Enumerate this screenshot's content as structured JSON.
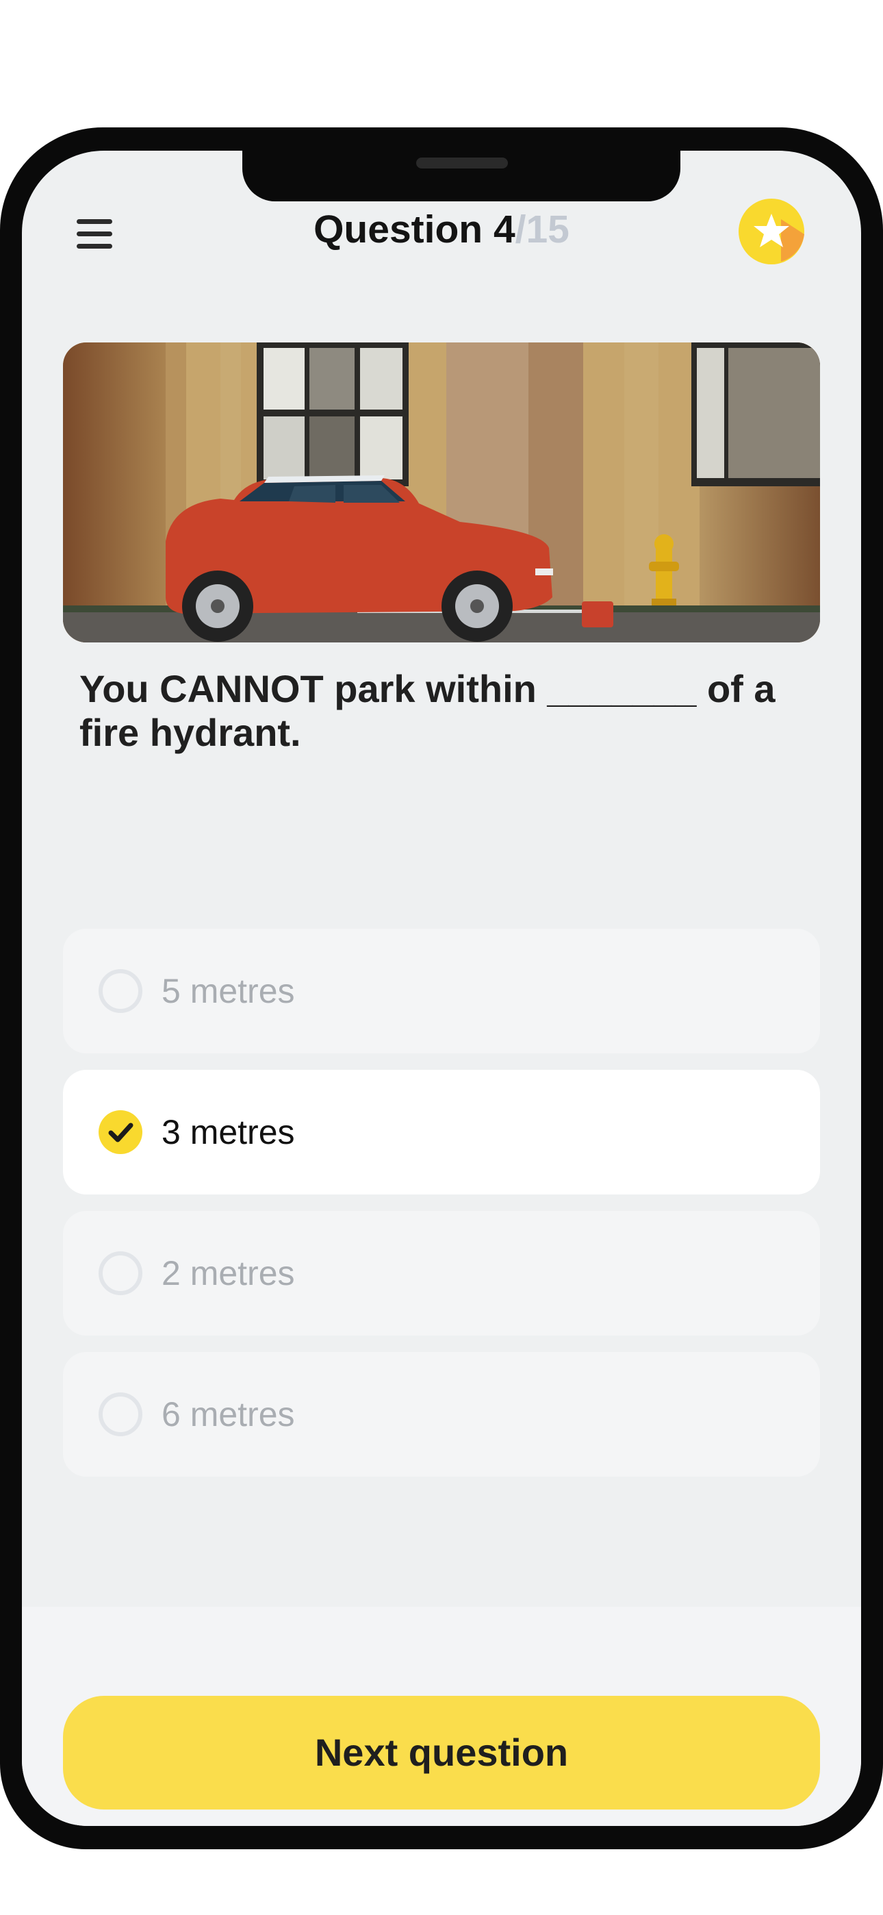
{
  "header": {
    "title_prefix": "Question 4",
    "title_total": "/15",
    "menu_icon": "hamburger-menu-icon",
    "badge_icon": "star-icon",
    "accent_color": "#f9d92e"
  },
  "image": {
    "subject": "red-mini-car-parked-beside-yellow-fire-hydrant"
  },
  "question": {
    "text": "You  CANNOT park within _______ of a fire hydrant."
  },
  "options": [
    {
      "label": "5 metres",
      "selected": false
    },
    {
      "label": "3 metres",
      "selected": true
    },
    {
      "label": "2 metres",
      "selected": false
    },
    {
      "label": "6 metres",
      "selected": false
    }
  ],
  "footer": {
    "next_label": "Next question",
    "button_color": "#fadd4c"
  }
}
